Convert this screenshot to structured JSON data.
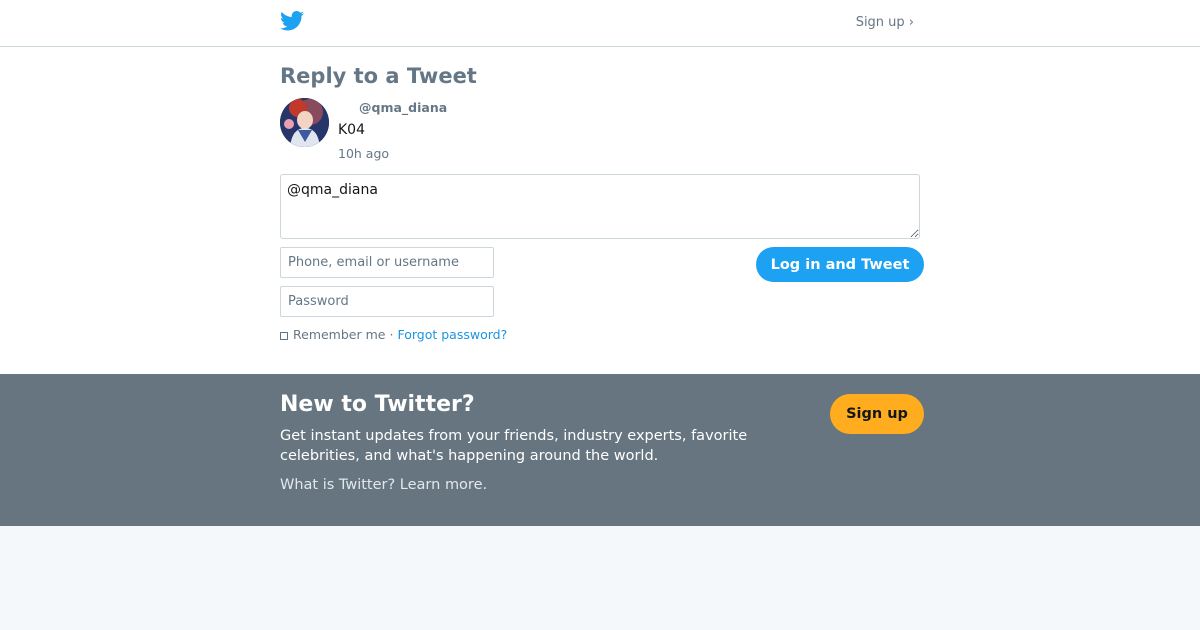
{
  "header": {
    "logo_icon": "twitter-bird-icon",
    "signup_link": "Sign up ›"
  },
  "page": {
    "title": "Reply to a Tweet"
  },
  "tweet": {
    "handle": "@qma_diana",
    "text": "K04",
    "time": "10h ago"
  },
  "reply": {
    "value": "@qma_diana"
  },
  "login": {
    "username_placeholder": "Phone, email or username",
    "password_placeholder": "Password",
    "remember_label": "Remember me",
    "separator": "·",
    "forgot_label": "Forgot password?",
    "submit_label": "Log in and Tweet"
  },
  "signup_band": {
    "title": "New to Twitter?",
    "text": "Get instant updates from your friends, industry experts, favorite celebrities, and what's happening around the world.",
    "learn_more": "What is Twitter? Learn more.",
    "button_label": "Sign up"
  },
  "colors": {
    "brand_blue": "#1da1f2",
    "signup_orange": "#ffad1f",
    "band_gray": "#66757f"
  }
}
